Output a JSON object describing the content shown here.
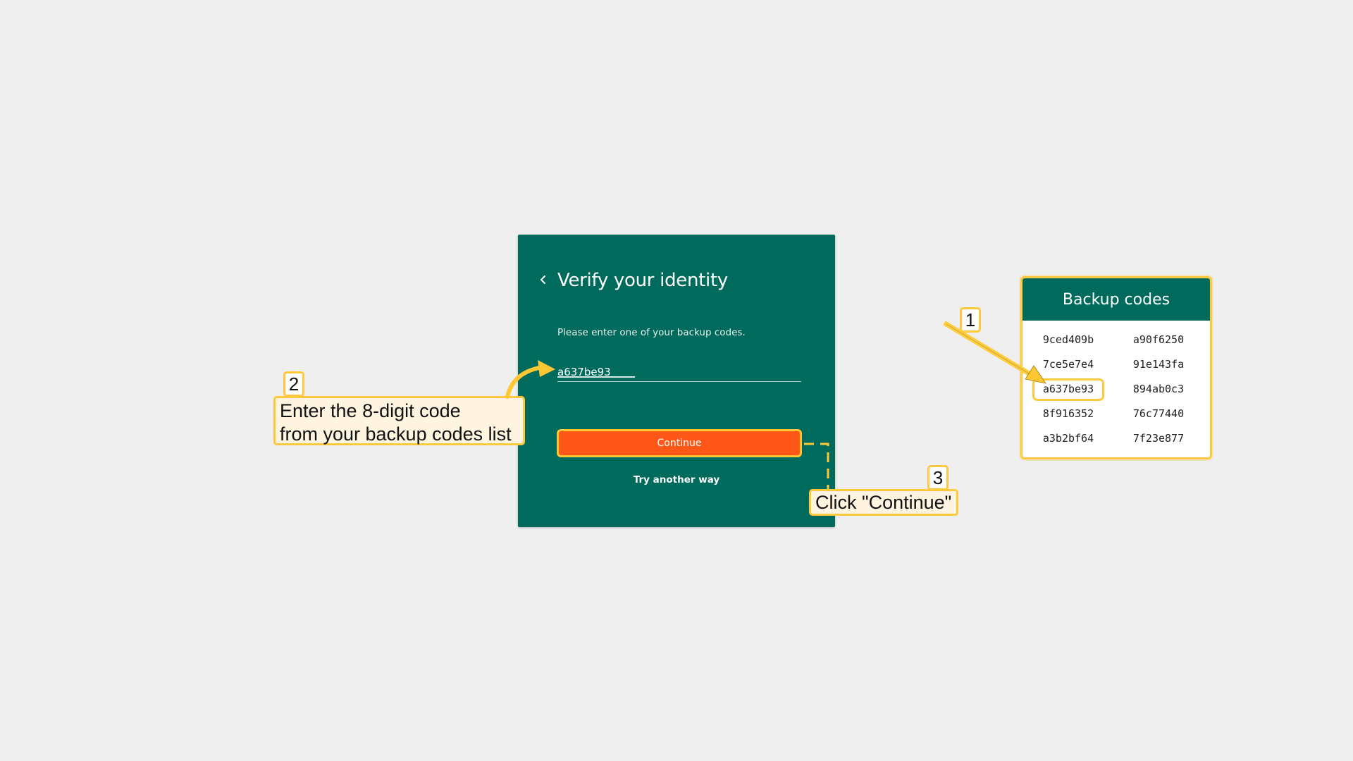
{
  "card": {
    "title": "Verify your identity",
    "instruction": "Please enter one of your backup codes.",
    "code_input_value": "a637be93",
    "continue_label": "Continue",
    "alternate_link": "Try another way"
  },
  "backup_panel": {
    "title": "Backup codes",
    "codes": [
      "9ced409b",
      "a90f6250",
      "7ce5e7e4",
      "91e143fa",
      "a637be93",
      "894ab0c3",
      "8f916352",
      "76c77440",
      "a3b2bf64",
      "7f23e877"
    ],
    "highlighted_code": "a637be93"
  },
  "annotations": {
    "step1": {
      "number": "1"
    },
    "step2": {
      "number": "2",
      "lines": [
        "Enter the 8-digit code",
        "from your backup codes list"
      ]
    },
    "step3": {
      "number": "3",
      "text": "Click \"Continue\""
    }
  },
  "colors": {
    "card_bg": "#006b5c",
    "accent_orange": "#ff5718",
    "highlight_yellow": "#ffc83d",
    "page_bg": "#efefef"
  }
}
